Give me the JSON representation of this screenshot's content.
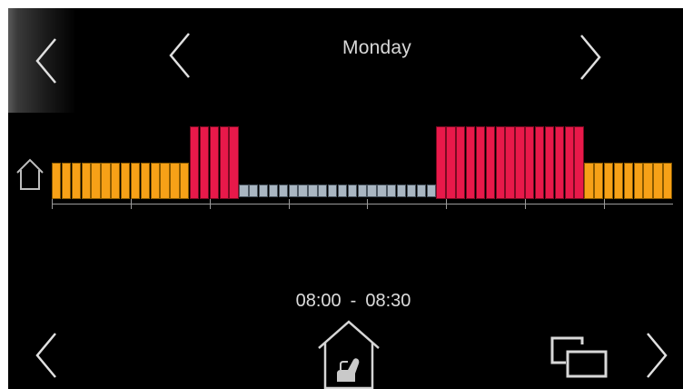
{
  "header": {
    "day": "Monday"
  },
  "icons": {
    "back": "chevron-left-icon",
    "prev_day": "chevron-left-icon",
    "next_day": "chevron-right-icon",
    "home_marker": "house-outline-icon",
    "present": "house-with-chair-icon",
    "copy": "copy-windows-icon",
    "prev_slot": "chevron-left-icon",
    "next_slot": "chevron-right-icon"
  },
  "colors": {
    "comfort": "#e8194a",
    "eco": "#f7a117",
    "off": "#a9b6c2",
    "background": "#000000",
    "text": "#dcdcdc"
  },
  "schedule": {
    "slot_count": 48,
    "slot_minutes": 30,
    "levels": [
      "eco",
      "eco",
      "eco",
      "eco",
      "eco",
      "eco",
      "eco",
      "eco",
      "eco",
      "eco",
      "eco",
      "eco",
      "eco",
      "eco",
      "comfort",
      "comfort",
      "comfort",
      "comfort",
      "comfort",
      "off",
      "off",
      "off",
      "off",
      "off",
      "off",
      "off",
      "off",
      "off",
      "off",
      "off",
      "off",
      "off",
      "off",
      "off",
      "off",
      "off",
      "off",
      "off",
      "off",
      "comfort",
      "comfort",
      "comfort",
      "comfort",
      "comfort",
      "comfort",
      "comfort",
      "comfort",
      "comfort",
      "comfort",
      "comfort",
      "comfort",
      "comfort",
      "comfort",
      "comfort",
      "eco",
      "eco",
      "eco",
      "eco",
      "eco",
      "eco",
      "eco",
      "eco",
      "eco"
    ]
  },
  "selection": {
    "start": "08:00",
    "separator": "-",
    "end": "08:30"
  }
}
